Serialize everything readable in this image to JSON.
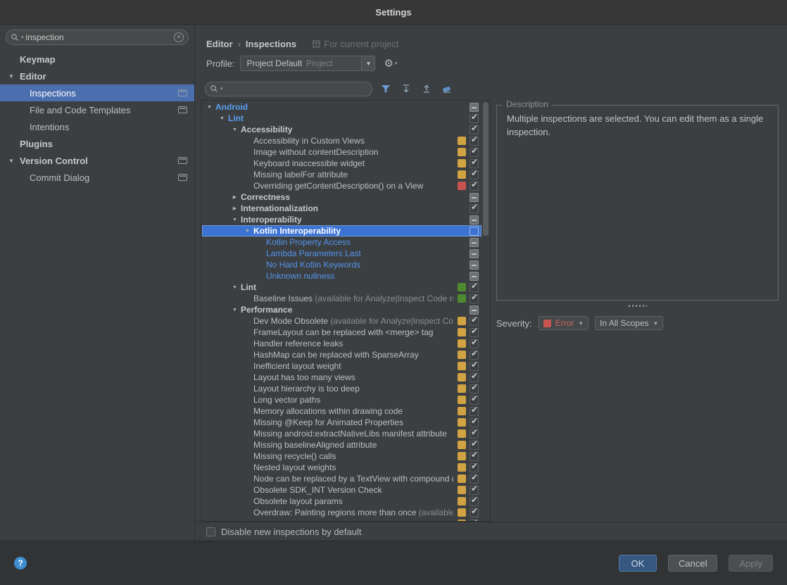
{
  "window": {
    "title": "Settings"
  },
  "colors": {
    "accent": "#4b6eaf",
    "selection": "#3c73d3",
    "warning": "#d1a343",
    "error": "#c75450",
    "success": "#4d8a2f"
  },
  "sidebar": {
    "search": {
      "value": "inspection"
    },
    "items": [
      {
        "label": "Keymap",
        "level": 0,
        "bold": true
      },
      {
        "label": "Editor",
        "level": 0,
        "bold": true,
        "arrow": "expanded"
      },
      {
        "label": "Inspections",
        "level": 1,
        "selected": true,
        "icon": true
      },
      {
        "label": "File and Code Templates",
        "level": 1,
        "icon": true
      },
      {
        "label": "Intentions",
        "level": 1
      },
      {
        "label": "Plugins",
        "level": 0,
        "bold": true
      },
      {
        "label": "Version Control",
        "level": 0,
        "bold": true,
        "arrow": "expanded",
        "icon": true
      },
      {
        "label": "Commit Dialog",
        "level": 1,
        "icon": true
      }
    ]
  },
  "header": {
    "breadcrumb": {
      "parent": "Editor",
      "separator": "›",
      "current": "Inspections",
      "scope": "For current project"
    },
    "profile": {
      "label": "Profile:",
      "value": "Project Default",
      "hint": "Project"
    }
  },
  "toolbar": {
    "search_value": ""
  },
  "tree": {
    "rows": [
      {
        "label": "Android",
        "level": 0,
        "arrow": "expanded",
        "style": "blue",
        "check": "partial"
      },
      {
        "label": "Lint",
        "level": 1,
        "arrow": "expanded",
        "style": "blue",
        "check": "checked"
      },
      {
        "label": "Accessibility",
        "level": 2,
        "arrow": "expanded",
        "style": "bold",
        "check": "checked"
      },
      {
        "label": "Accessibility in Custom Views",
        "level": 3,
        "badge": "warning",
        "check": "checked"
      },
      {
        "label": "Image without contentDescription",
        "level": 3,
        "badge": "warning",
        "check": "checked"
      },
      {
        "label": "Keyboard inaccessible widget",
        "level": 3,
        "badge": "warning",
        "check": "checked"
      },
      {
        "label": "Missing labelFor attribute",
        "level": 3,
        "badge": "warning",
        "check": "checked"
      },
      {
        "label": "Overriding getContentDescription() on a View",
        "level": 3,
        "badge": "error",
        "check": "checked"
      },
      {
        "label": "Correctness",
        "level": 2,
        "arrow": "collapsed",
        "style": "bold",
        "check": "partial"
      },
      {
        "label": "Internationalization",
        "level": 2,
        "arrow": "collapsed",
        "style": "bold",
        "check": "checked"
      },
      {
        "label": "Interoperability",
        "level": 2,
        "arrow": "expanded",
        "style": "bold",
        "check": "partial"
      },
      {
        "label": "Kotlin Interoperability",
        "level": 3,
        "arrow": "expanded",
        "style": "bold",
        "selected": true,
        "check": "unchecked"
      },
      {
        "label": "Kotlin Property Access",
        "level": 4,
        "style": "link",
        "check": "partial"
      },
      {
        "label": "Lambda Parameters Last",
        "level": 4,
        "style": "link",
        "check": "partial"
      },
      {
        "label": "No Hard Kotlin Keywords",
        "level": 4,
        "style": "link",
        "check": "partial"
      },
      {
        "label": "Unknown nullness",
        "level": 4,
        "style": "link",
        "check": "partial"
      },
      {
        "label": "Lint",
        "level": 2,
        "arrow": "expanded",
        "style": "bold",
        "badge": "success",
        "check": "checked"
      },
      {
        "label": "Baseline Issues",
        "note": "(available for Analyze|Inspect Code run on the whole project)",
        "level": 3,
        "badge": "success",
        "check": "checked"
      },
      {
        "label": "Performance",
        "level": 2,
        "arrow": "expanded",
        "style": "bold",
        "check": "partial"
      },
      {
        "label": "Dev Mode Obsolete",
        "note": "(available for Analyze|Inspect Code)",
        "level": 3,
        "badge": "warning",
        "check": "checked"
      },
      {
        "label": "FrameLayout can be replaced with <merge> tag",
        "level": 3,
        "badge": "warning",
        "check": "checked"
      },
      {
        "label": "Handler reference leaks",
        "level": 3,
        "badge": "warning",
        "check": "checked"
      },
      {
        "label": "HashMap can be replaced with SparseArray",
        "level": 3,
        "badge": "warning",
        "check": "checked"
      },
      {
        "label": "Inefficient layout weight",
        "level": 3,
        "badge": "warning",
        "check": "checked"
      },
      {
        "label": "Layout has too many views",
        "level": 3,
        "badge": "warning",
        "check": "checked"
      },
      {
        "label": "Layout hierarchy is too deep",
        "level": 3,
        "badge": "warning",
        "check": "checked"
      },
      {
        "label": "Long vector paths",
        "level": 3,
        "badge": "warning",
        "check": "checked"
      },
      {
        "label": "Memory allocations within drawing code",
        "level": 3,
        "badge": "warning",
        "check": "checked"
      },
      {
        "label": "Missing @Keep for Animated Properties",
        "level": 3,
        "badge": "warning",
        "check": "checked"
      },
      {
        "label": "Missing android:extractNativeLibs manifest attribute",
        "level": 3,
        "badge": "warning",
        "check": "checked"
      },
      {
        "label": "Missing baselineAligned attribute",
        "level": 3,
        "badge": "warning",
        "check": "checked"
      },
      {
        "label": "Missing recycle() calls",
        "level": 3,
        "badge": "warning",
        "check": "checked"
      },
      {
        "label": "Nested layout weights",
        "level": 3,
        "badge": "warning",
        "check": "checked"
      },
      {
        "label": "Node can be replaced by a TextView with compound drawables",
        "level": 3,
        "badge": "warning",
        "check": "checked"
      },
      {
        "label": "Obsolete SDK_INT Version Check",
        "level": 3,
        "badge": "warning",
        "check": "checked"
      },
      {
        "label": "Obsolete layout params",
        "level": 3,
        "badge": "warning",
        "check": "checked"
      },
      {
        "label": "Overdraw: Painting regions more than once",
        "note": "(available)",
        "level": 3,
        "badge": "warning",
        "check": "checked"
      },
      {
        "label": "",
        "level": 3,
        "badge": "warning",
        "check": "checked",
        "clipped": true
      }
    ]
  },
  "description": {
    "title": "Description",
    "text": "Multiple inspections are selected. You can edit them as a single inspection."
  },
  "severity": {
    "label": "Severity:",
    "value": "Error",
    "scope": "In All Scopes"
  },
  "options": {
    "disable_new": "Disable new inspections by default"
  },
  "actions": {
    "ok": "OK",
    "cancel": "Cancel",
    "apply": "Apply"
  }
}
